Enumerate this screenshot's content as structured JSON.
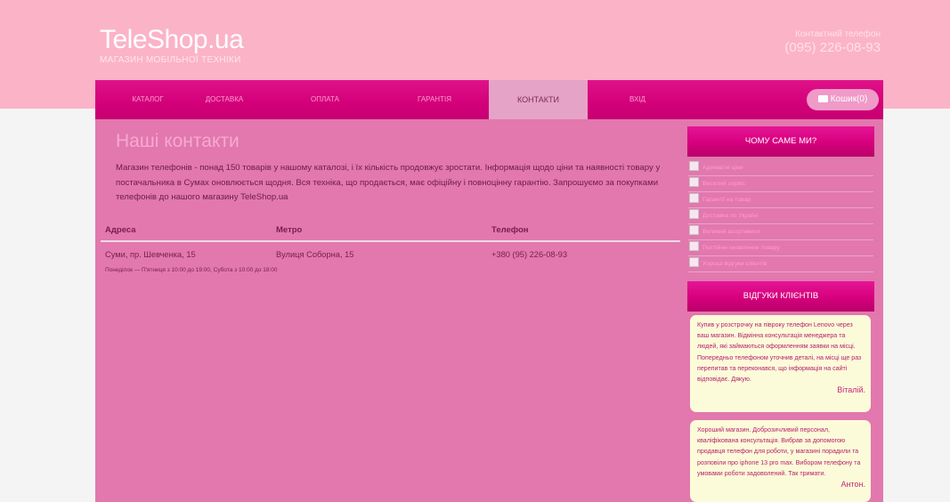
{
  "header": {
    "logo_title": "TeleShop.ua",
    "logo_subtitle": "МАГАЗИН МОБІЛЬНОЇ ТЕХНІКИ",
    "contact_label": "Контактний телефон",
    "contact_phone": "(095) 226-08-93"
  },
  "nav": {
    "items": [
      "КАТАЛОГ",
      "ДОСТАВКА",
      "ОПЛАТА",
      "ГАРАНТІЯ",
      "КОНТАКТИ",
      "ВХІД"
    ],
    "active": "КОНТАКТИ",
    "cart_label": "Кошик(0)",
    "cart_icon": "cart-icon"
  },
  "main": {
    "title": "Наші контакти",
    "intro": "Магазин телефонів - понад 150 товарів у нашому каталозі, і їх кількість продовжує зростати. Інформація щодо ціни та наявності товару у постачальника в Сумах оновлюється щодня. Вся техніка, що продається, має офіційну і повноцінну гарантію. Запрошуємо за покупками телефонів до нашого магазину TeleShop.ua",
    "table": {
      "headers": [
        "Адреса",
        "Метро",
        "Телефон"
      ],
      "row": {
        "address": "Суми, пр. Шевченка, 15",
        "metro": "Вулиця Соборна, 15",
        "phone": "+380 (95) 226-08-93",
        "hours": "Понеділок — П'ятниця з 10:00 до 19:00, Субота з 10:00 до 18:00"
      }
    }
  },
  "sidebar": {
    "why_title": "ЧОМУ САМЕ МИ?",
    "why_items": [
      "Адекватні ціни",
      "Веселий сервіс",
      "Гарантії на товар",
      "Доставка по Україні",
      "Великий асортимент",
      "Постійне оновлення товару",
      "Хороші відгуки клієнтів"
    ],
    "reviews_title": "ВІДГУКИ КЛІЄНТІВ",
    "reviews": [
      {
        "text": "Купив у розстрочку на півроку телефон Lenovo через ваш магазин. Відмінна консультація менеджера та людей, які займаються оформленням заявки на місці. Попередньо телефоном уточнив деталі, на місці ще раз перепитав та переконався, що інформація на сайті відповідає. Дякую.",
        "author": "Віталій."
      },
      {
        "text": "Хороший магазин. Доброзичливий персонал, кваліфікована консультація. Вибрав за допомогою продавця телефон для роботи, у магазині порадили та розповіли про iphone 13 pro max. Вибором телефону та умовами роботи задоволений. Так тримати.",
        "author": "Антон."
      }
    ]
  },
  "colors": {
    "top_band": "#fbb3c8",
    "nav": "#d30079",
    "content": "#e278ad",
    "review_bg": "#fbfbd9"
  }
}
